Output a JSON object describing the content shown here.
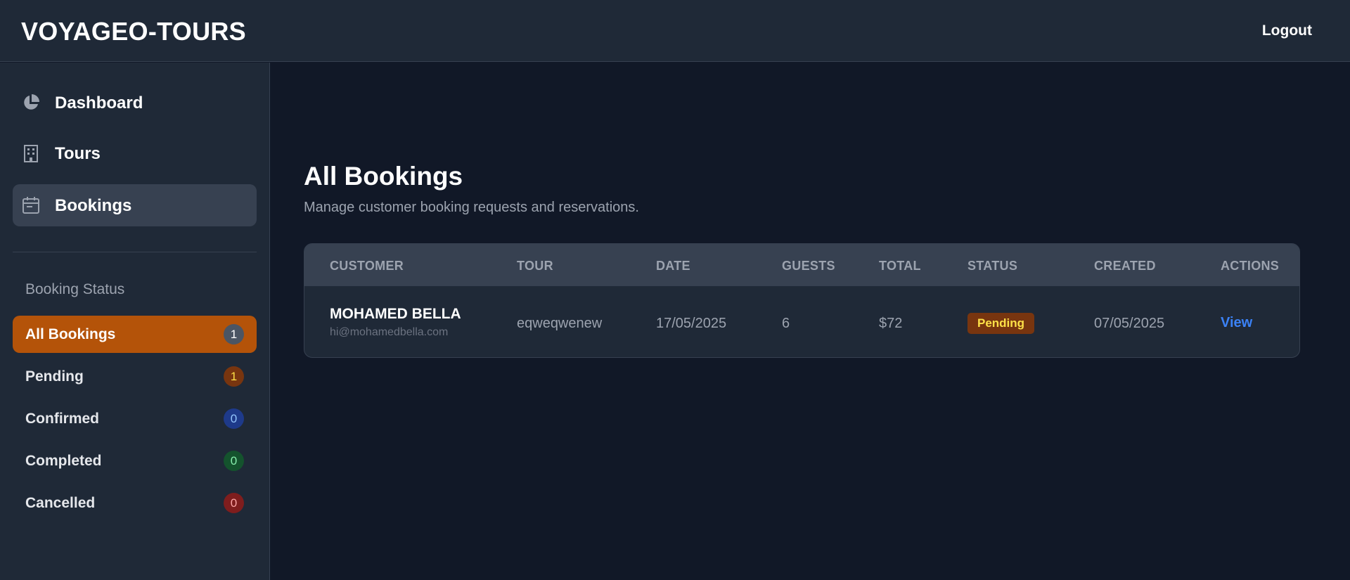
{
  "header": {
    "brand": "VOYAGEO-TOURS",
    "logout": "Logout"
  },
  "sidebar": {
    "nav": [
      {
        "label": "Dashboard",
        "icon": "pie-chart-icon",
        "active": false
      },
      {
        "label": "Tours",
        "icon": "building-icon",
        "active": false
      },
      {
        "label": "Bookings",
        "icon": "calendar-icon",
        "active": true
      }
    ],
    "status_heading": "Booking Status",
    "statuses": [
      {
        "label": "All Bookings",
        "count": "1",
        "active": true,
        "badge_bg": "#4b5563",
        "badge_fg": "#ffffff"
      },
      {
        "label": "Pending",
        "count": "1",
        "active": false,
        "badge_bg": "#78350f",
        "badge_fg": "#fde047"
      },
      {
        "label": "Confirmed",
        "count": "0",
        "active": false,
        "badge_bg": "#1e3a8a",
        "badge_fg": "#93c5fd"
      },
      {
        "label": "Completed",
        "count": "0",
        "active": false,
        "badge_bg": "#14532d",
        "badge_fg": "#86efac"
      },
      {
        "label": "Cancelled",
        "count": "0",
        "active": false,
        "badge_bg": "#7f1d1d",
        "badge_fg": "#fca5a5"
      }
    ]
  },
  "main": {
    "title": "All Bookings",
    "subtitle": "Manage customer booking requests and reservations.",
    "table": {
      "headers": [
        "Customer",
        "Tour",
        "Date",
        "Guests",
        "Total",
        "Status",
        "Created",
        "Actions"
      ],
      "rows": [
        {
          "customer_name": "MOHAMED BELLA",
          "customer_email": "hi@mohamedbella.com",
          "tour": "eqweqwenew",
          "date": "17/05/2025",
          "guests": "6",
          "total": "$72",
          "status": "Pending",
          "created": "07/05/2025",
          "action": "View"
        }
      ]
    }
  },
  "colors": {
    "accent": "#b45309",
    "link": "#3b82f6",
    "bg": "#111827",
    "panel": "#1f2937"
  }
}
